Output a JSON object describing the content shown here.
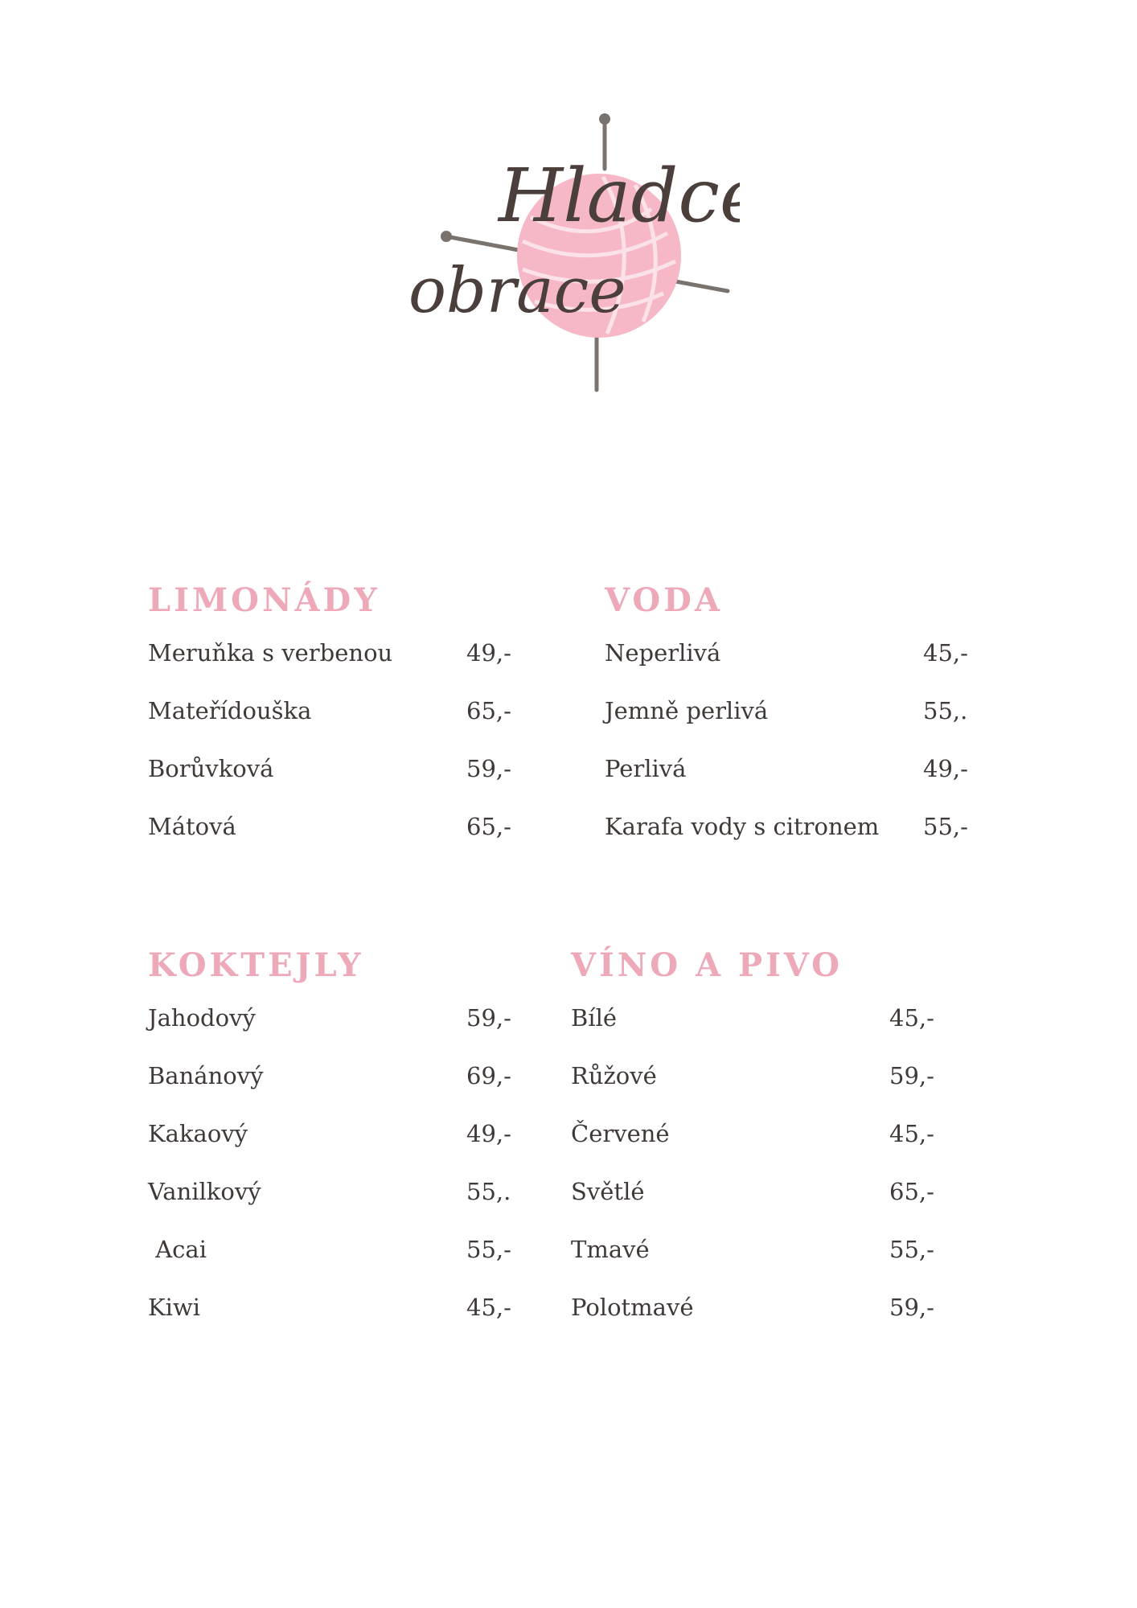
{
  "logo": {
    "line1": "Hladce",
    "line2": "obrace",
    "colors": {
      "yarn": "#f6b8c6",
      "needle": "#7a726c",
      "script": "#4a3f3a"
    }
  },
  "sections": {
    "limonady": {
      "title": "LIMONÁDY",
      "items": [
        {
          "name": "Meruňka s verbenou",
          "price": "49,-"
        },
        {
          "name": "Mateřídouška",
          "price": "65,-"
        },
        {
          "name": "Borůvková",
          "price": "59,-"
        },
        {
          "name": "Mátová",
          "price": "65,-"
        }
      ]
    },
    "voda": {
      "title": "VODA",
      "items": [
        {
          "name": "Neperlivá",
          "price": "45,-"
        },
        {
          "name": "Jemně perlivá",
          "price": "55,."
        },
        {
          "name": "Perlivá",
          "price": "49,-"
        },
        {
          "name": "Karafa vody s citronem",
          "price": "55,-"
        }
      ]
    },
    "koktejly": {
      "title": "KOKTEJLY",
      "items": [
        {
          "name": "Jahodový",
          "price": "59,-"
        },
        {
          "name": "Banánový",
          "price": "69,-"
        },
        {
          "name": "Kakaový",
          "price": "49,-"
        },
        {
          "name": "Vanilkový",
          "price": "55,."
        },
        {
          "name": " Acai",
          "price": "55,-"
        },
        {
          "name": "Kiwi",
          "price": "45,-"
        }
      ]
    },
    "vino": {
      "title": "VÍNO A PIVO",
      "items": [
        {
          "name": "Bílé",
          "price": "45,-"
        },
        {
          "name": "Růžové",
          "price": "59,-"
        },
        {
          "name": "Červené",
          "price": "45,-"
        },
        {
          "name": "Světlé",
          "price": "65,-"
        },
        {
          "name": "Tmavé",
          "price": "55,-"
        },
        {
          "name": "Polotmavé",
          "price": "59,-"
        }
      ]
    }
  },
  "accent_color": "#eea9b9",
  "text_color": "#3f3a37"
}
